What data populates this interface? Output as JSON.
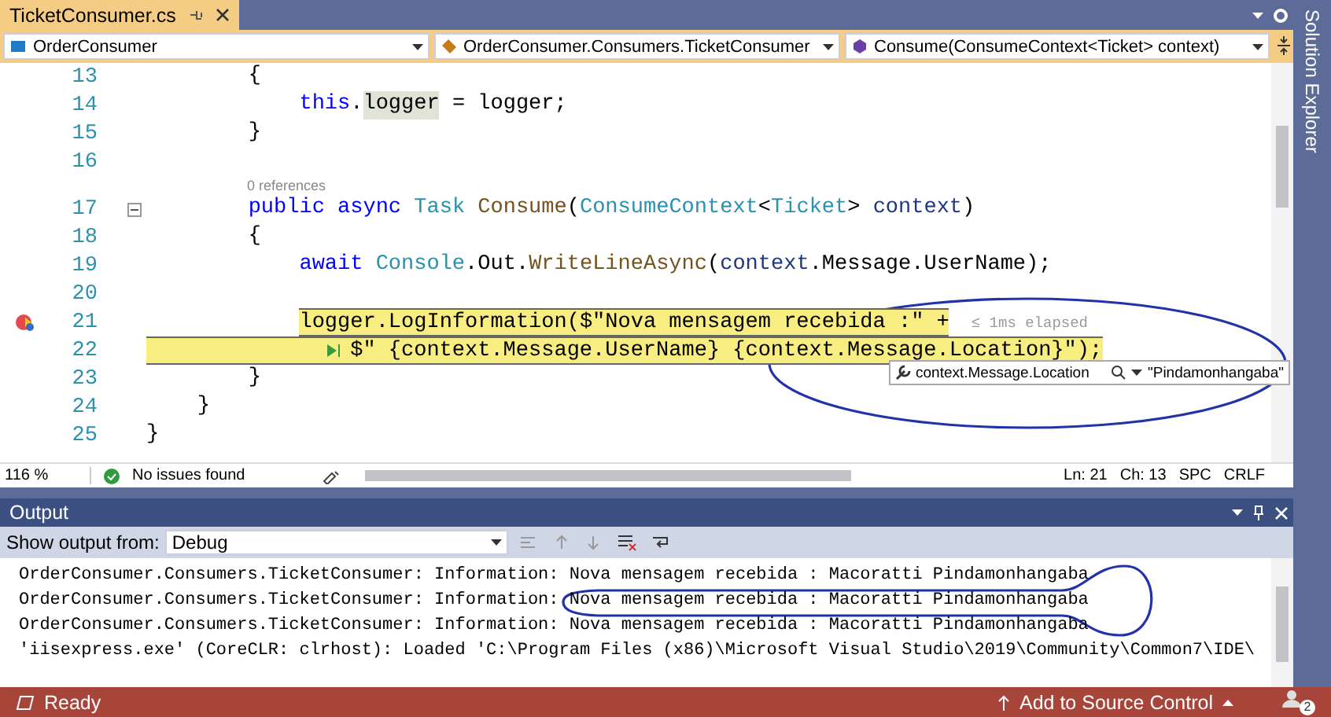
{
  "document_tab": {
    "title": "TicketConsumer.cs",
    "selected": true
  },
  "side_panel": {
    "title": "Solution Explorer"
  },
  "nav_bar": [
    {
      "label": "OrderConsumer",
      "kind": "project"
    },
    {
      "label": "OrderConsumer.Consumers.TicketConsumer",
      "kind": "class"
    },
    {
      "label": "Consume(ConsumeContext<Ticket> context)",
      "kind": "method"
    }
  ],
  "code_lines": [
    {
      "number": "13",
      "highlighted": false,
      "tokens": [
        {
          "text": "        {",
          "kind": "plain"
        }
      ]
    },
    {
      "number": "14",
      "highlighted": false,
      "tokens": [
        {
          "text": "            this",
          "kind": "keyword"
        },
        {
          "text": ".",
          "kind": "plain"
        },
        {
          "text": "logger",
          "kind": "reference"
        },
        {
          "text": " = logger;",
          "kind": "plain"
        }
      ]
    },
    {
      "number": "15",
      "highlighted": false,
      "tokens": [
        {
          "text": "        }",
          "kind": "plain"
        }
      ]
    },
    {
      "number": "16"
    },
    {
      "lens": "0 references"
    },
    {
      "number": "17",
      "highlighted": false,
      "fold": true,
      "tokens": [
        {
          "text": "        public async ",
          "kind": "keyword"
        },
        {
          "text": "Task ",
          "kind": "type"
        },
        {
          "text": "Consume",
          "kind": "method"
        },
        {
          "text": "(",
          "kind": "plain"
        },
        {
          "text": "ConsumeContext",
          "kind": "type"
        },
        {
          "text": "<",
          "kind": "plain"
        },
        {
          "text": "Ticket",
          "kind": "type"
        },
        {
          "text": "> ",
          "kind": "plain"
        },
        {
          "text": "context",
          "kind": "param"
        },
        {
          "text": ")",
          "kind": "plain"
        }
      ]
    },
    {
      "number": "18",
      "highlighted": false,
      "tokens": [
        {
          "text": "        {",
          "kind": "plain"
        }
      ]
    },
    {
      "number": "19",
      "highlighted": false,
      "tokens": [
        {
          "text": "            await ",
          "kind": "keyword"
        },
        {
          "text": "Console",
          "kind": "type"
        },
        {
          "text": ".Out.",
          "kind": "plain"
        },
        {
          "text": "WriteLineAsync",
          "kind": "method"
        },
        {
          "text": "(",
          "kind": "plain"
        },
        {
          "text": "context",
          "kind": "param"
        },
        {
          "text": ".Message.UserName);",
          "kind": "plain"
        }
      ]
    },
    {
      "number": "20"
    },
    {
      "number": "21",
      "highlighted": true,
      "breakpoint": true,
      "tokens": [
        {
          "text": "            logger",
          "kind": "reference"
        },
        {
          "text": ".LogInformation($\"Nova mensagem recebida :\" +",
          "kind": "plain"
        }
      ],
      "perf_tip": "≤ 1ms elapsed"
    },
    {
      "number": "22",
      "highlighted": true,
      "tokens": [
        {
          "kind": "run_to_click"
        },
        {
          "text": "$\" {context.Message.UserName} {context.Message.Location}\");",
          "kind": "plain"
        }
      ]
    },
    {
      "number": "23",
      "highlighted": false,
      "tokens": [
        {
          "text": "        }",
          "kind": "plain"
        }
      ]
    },
    {
      "number": "24",
      "highlighted": false,
      "tokens": [
        {
          "text": "    }",
          "kind": "plain"
        }
      ]
    },
    {
      "number": "25",
      "highlighted": false,
      "tokens": [
        {
          "text": "}",
          "kind": "plain"
        }
      ]
    }
  ],
  "data_tip": {
    "expression": "context.Message.Location",
    "value": "\"Pindamonhangaba\""
  },
  "editor_status": {
    "zoom": "116 %",
    "issues": "No issues found",
    "line": "Ln: 21",
    "column": "Ch: 13",
    "spacing": "SPC",
    "line_ending": "CRLF"
  },
  "output": {
    "title": "Output",
    "source_label": "Show output from:",
    "source": "Debug",
    "lines": [
      "OrderConsumer.Consumers.TicketConsumer: Information: Nova mensagem recebida : Macoratti Pindamonhangaba",
      "OrderConsumer.Consumers.TicketConsumer: Information: Nova mensagem recebida : Macoratti Pindamonhangaba",
      "OrderConsumer.Consumers.TicketConsumer: Information: Nova mensagem recebida : Macoratti Pindamonhangaba",
      "'iisexpress.exe' (CoreCLR: clrhost): Loaded 'C:\\Program Files (x86)\\Microsoft Visual Studio\\2019\\Community\\Common7\\IDE\\"
    ]
  },
  "status_bar": {
    "state": "Ready",
    "source_control": "Add to Source Control",
    "notifications": "2"
  }
}
